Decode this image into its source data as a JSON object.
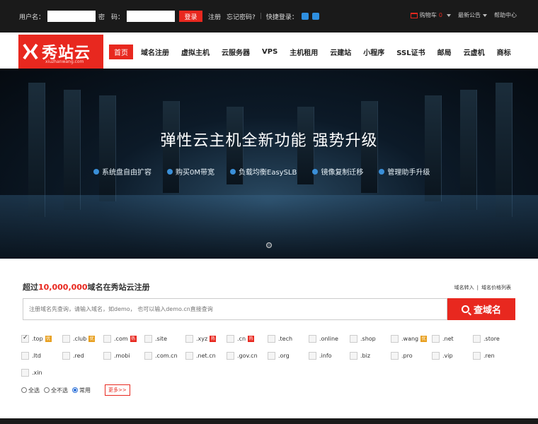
{
  "topbar": {
    "username_label": "用户名：",
    "password_label": "密　码：",
    "login_button": "登录",
    "register": "注册",
    "forgot": "忘记密码?",
    "quick_login": "快捷登录：",
    "cart": "购物车",
    "cart_count": "0",
    "news": "最新公告",
    "help": "帮助中心"
  },
  "logo": {
    "name": "秀站云",
    "sub": "xiuzhanwang.com"
  },
  "nav": {
    "items": [
      "首页",
      "域名注册",
      "虚拟主机",
      "云服务器",
      "VPS",
      "主机租用",
      "云建站",
      "小程序",
      "SSL证书",
      "邮局",
      "云虚机",
      "商标"
    ]
  },
  "banner": {
    "title": "弹性云主机全新功能  强势升级",
    "features": [
      "系统盘自由扩容",
      "购买0M带宽",
      "负载均衡EasySLB",
      "镜像复制迁移",
      "管理助手升级"
    ]
  },
  "domain": {
    "headline_prefix": "超过",
    "headline_num": "10,000,000",
    "headline_suffix": "域名在秀站云注册",
    "link_transfer": "域名转入",
    "link_prices": "域名价格列表",
    "search_placeholder": "注册域名先查询，请输入域名，如demo， 也可以输入demo.cn直接查询",
    "search_button": "查域名",
    "tlds": [
      {
        "name": ".top",
        "checked": true,
        "badge": "优",
        "badge_type": "you"
      },
      {
        "name": ".club",
        "checked": false,
        "badge": "优",
        "badge_type": "you"
      },
      {
        "name": ".com",
        "checked": false,
        "badge": "热",
        "badge_type": "hot"
      },
      {
        "name": ".site",
        "checked": false,
        "badge": "",
        "badge_type": ""
      },
      {
        "name": ".xyz",
        "checked": false,
        "badge": "热",
        "badge_type": "hot"
      },
      {
        "name": ".cn",
        "checked": false,
        "badge": "热",
        "badge_type": "hot"
      },
      {
        "name": ".tech",
        "checked": false,
        "badge": "",
        "badge_type": ""
      },
      {
        "name": ".online",
        "checked": false,
        "badge": "",
        "badge_type": ""
      },
      {
        "name": ".shop",
        "checked": false,
        "badge": "",
        "badge_type": ""
      },
      {
        "name": ".wang",
        "checked": false,
        "badge": "优",
        "badge_type": "you"
      },
      {
        "name": ".net",
        "checked": false,
        "badge": "",
        "badge_type": ""
      },
      {
        "name": ".store",
        "checked": false,
        "badge": "",
        "badge_type": ""
      },
      {
        "name": ".ltd",
        "checked": false,
        "badge": "",
        "badge_type": ""
      },
      {
        "name": ".red",
        "checked": false,
        "badge": "",
        "badge_type": ""
      },
      {
        "name": ".mobi",
        "checked": false,
        "badge": "",
        "badge_type": ""
      },
      {
        "name": ".com.cn",
        "checked": false,
        "badge": "",
        "badge_type": ""
      },
      {
        "name": ".net.cn",
        "checked": false,
        "badge": "",
        "badge_type": ""
      },
      {
        "name": ".gov.cn",
        "checked": false,
        "badge": "",
        "badge_type": ""
      },
      {
        "name": ".org",
        "checked": false,
        "badge": "",
        "badge_type": ""
      },
      {
        "name": ".info",
        "checked": false,
        "badge": "",
        "badge_type": ""
      },
      {
        "name": ".biz",
        "checked": false,
        "badge": "",
        "badge_type": ""
      },
      {
        "name": ".pro",
        "checked": false,
        "badge": "",
        "badge_type": ""
      },
      {
        "name": ".vip",
        "checked": false,
        "badge": "",
        "badge_type": ""
      },
      {
        "name": ".ren",
        "checked": false,
        "badge": "",
        "badge_type": ""
      },
      {
        "name": ".xin",
        "checked": false,
        "badge": "",
        "badge_type": ""
      }
    ],
    "radios": [
      {
        "label": "全选",
        "checked": false
      },
      {
        "label": "全不选",
        "checked": false
      },
      {
        "label": "常用",
        "checked": true
      }
    ],
    "more": "更多>>"
  },
  "colors": {
    "accent": "#e8281f",
    "topbar_bg": "#1a1a1a",
    "badge_you": "#e8a020"
  }
}
